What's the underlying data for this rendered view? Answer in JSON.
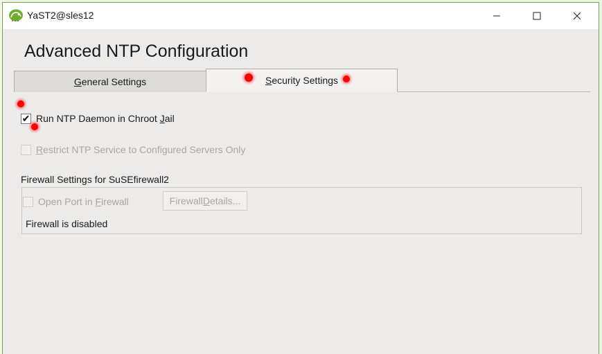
{
  "window": {
    "title": "YaST2@sles12",
    "controls": {
      "minimize": "minimize",
      "maximize": "maximize",
      "close": "close"
    }
  },
  "heading": "Advanced NTP Configuration",
  "tabs": [
    {
      "pre": "",
      "key": "G",
      "post": "eneral Settings",
      "active": false
    },
    {
      "pre": "",
      "key": "S",
      "post": "ecurity Settings",
      "active": true
    }
  ],
  "options": {
    "chroot": {
      "pre": "Run NTP Daemon in Chroot ",
      "key": "J",
      "post": "ail",
      "checked": true,
      "check_glyph": "✔"
    },
    "restrict": {
      "pre": "",
      "key": "R",
      "post": "estrict NTP Service to Configured Servers Only",
      "checked": false,
      "enabled": false
    }
  },
  "firewall": {
    "section_label": "Firewall Settings for SuSEfirewall2",
    "open_port": {
      "pre": "Open Port in ",
      "key": "F",
      "post": "irewall",
      "checked": false,
      "enabled": false
    },
    "details_button": {
      "pre": "Firewall ",
      "key": "D",
      "post": "etails...",
      "enabled": false
    },
    "status": "Firewall is disabled"
  },
  "colors": {
    "accent": "#6fae2c",
    "marker": "#ff0000"
  }
}
